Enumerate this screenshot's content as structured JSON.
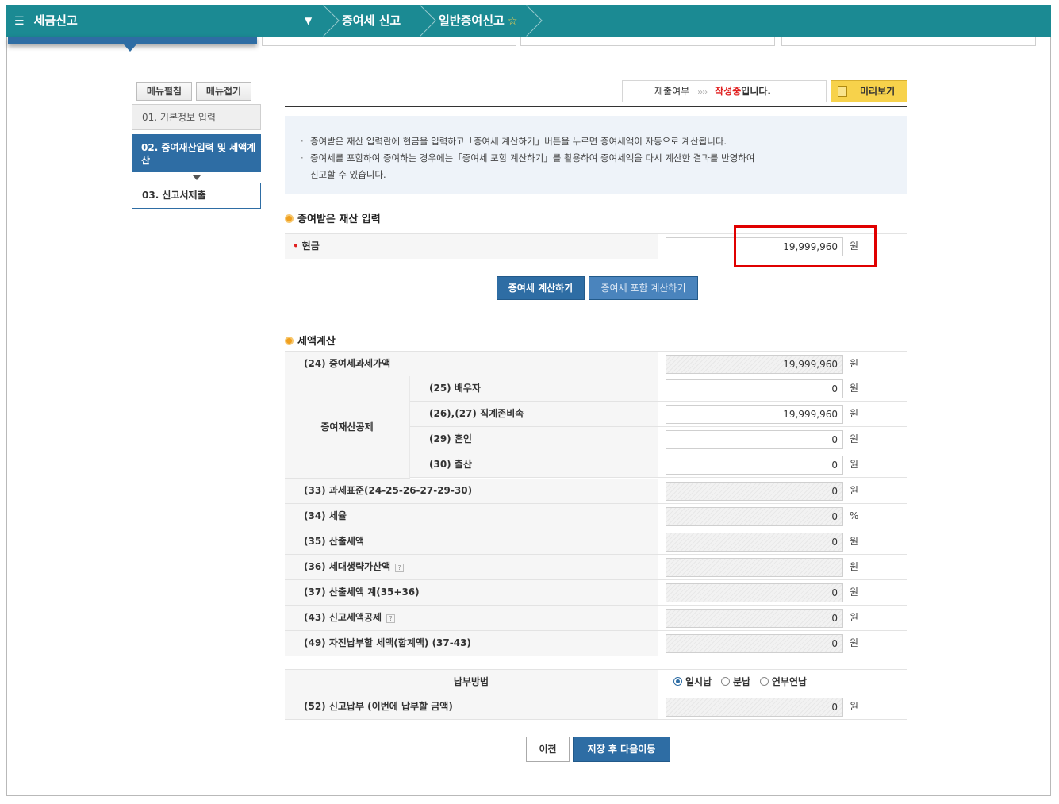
{
  "topbar": {
    "title": "세금신고",
    "breadcrumbs": [
      "증여세 신고",
      "일반증여신고"
    ]
  },
  "side_menu": {
    "expand_label": "메뉴펼침",
    "collapse_label": "메뉴접기",
    "steps": [
      {
        "label": "01. 기본정보 입력"
      },
      {
        "label": "02. 증여재산입력 및 세액계산"
      },
      {
        "label": "03. 신고서제출"
      }
    ]
  },
  "status": {
    "label": "제출여부",
    "arrows": "››››",
    "state": "작성중",
    "suffix": "입니다.",
    "preview_label": "미리보기"
  },
  "notice": [
    "증여받은 재산 입력란에 현금을 입력하고「증여세 계산하기」버튼을 누르면 증여세액이 자동으로 계산됩니다.",
    "증여세를 포함하여 증여하는 경우에는「증여세 포함 계산하기」를 활용하여 증여세액을 다시 계산한 결과를 반영하여",
    "신고할 수 있습니다."
  ],
  "asset_section": {
    "title": "증여받은 재산 입력",
    "cash_label": "현금",
    "cash_value": "19,999,960",
    "unit": "원",
    "calc_button": "증여세 계산하기",
    "calc_incl_button": "증여세 포함 계산하기"
  },
  "tax_section": {
    "title": "세액계산",
    "deduction_group": "증여재산공제",
    "rows": [
      {
        "label": "(24) 증여세과세가액",
        "value": "19,999,960",
        "unit": "원"
      },
      {
        "label": "(25) 배우자",
        "value": "0",
        "unit": "원"
      },
      {
        "label": "(26),(27) 직계존비속",
        "value": "19,999,960",
        "unit": "원"
      },
      {
        "label": "(29) 혼인",
        "value": "0",
        "unit": "원"
      },
      {
        "label": "(30) 출산",
        "value": "0",
        "unit": "원"
      },
      {
        "label": "(33) 과세표준(24-25-26-27-29-30)",
        "value": "0",
        "unit": "원"
      },
      {
        "label": "(34) 세율",
        "value": "0",
        "unit": "%"
      },
      {
        "label": "(35) 산출세액",
        "value": "0",
        "unit": "원"
      },
      {
        "label": "(36) 세대생략가산액",
        "value": "",
        "unit": "원"
      },
      {
        "label": "(37) 산출세액 계(35+36)",
        "value": "0",
        "unit": "원"
      },
      {
        "label": "(43) 신고세액공제",
        "value": "0",
        "unit": "원"
      },
      {
        "label": "(49) 자진납부할 세액(합계액) (37-43)",
        "value": "0",
        "unit": "원"
      }
    ]
  },
  "payment": {
    "method_label": "납부방법",
    "options": [
      "일시납",
      "분납",
      "연부연납"
    ],
    "selected": "일시납",
    "amount_label": "(52) 신고납부 (이번에 납부할 금액)",
    "amount_value": "0",
    "unit": "원"
  },
  "footer": {
    "prev_label": "이전",
    "next_label": "저장 후 다음이동"
  },
  "colors": {
    "topbar": "#1b8a93",
    "primary": "#2e6da4",
    "highlight": "#e00000",
    "preview": "#f7d24b"
  }
}
